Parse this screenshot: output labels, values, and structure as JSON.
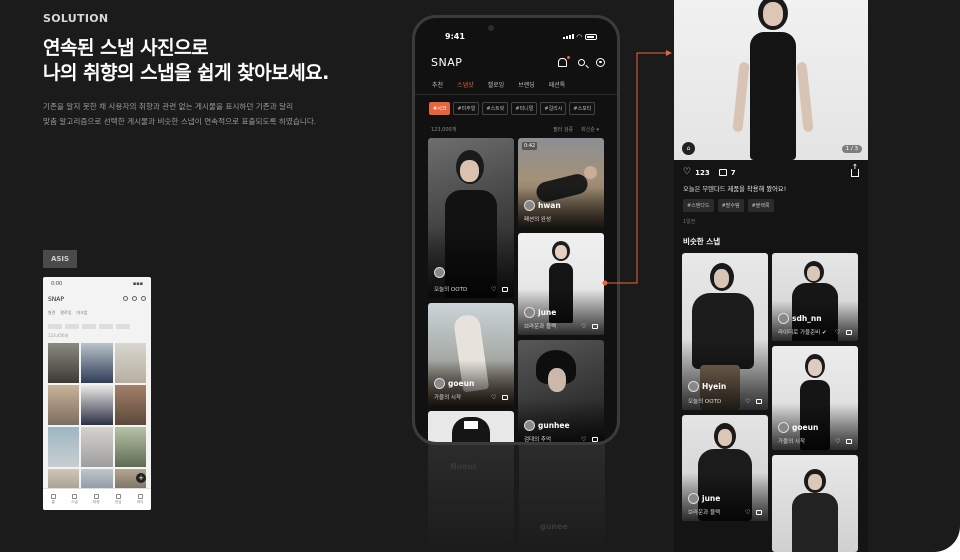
{
  "section_label": "SOLUTION",
  "headline": {
    "line1": "연속된 스냅 사진으로",
    "line2": "나의 취향의 스냅을 쉽게 찾아보세요."
  },
  "description": {
    "line1": "기존을 알지 못한 채 사용자의 취향과 관련 없는 게시물을 표시하던 기존과 달리",
    "line2": "맞춤 알고리즘으로 선택한 게시물과 비슷한 스냅이 연속적으로 표출되도록 하였습니다."
  },
  "asis": {
    "badge": "ASIS",
    "time": "0:00",
    "logo": "SNAP",
    "tabs": [
      "발견",
      "팔로잉",
      "마크업"
    ],
    "count": "123,456개",
    "nav": [
      "홈",
      "스냅",
      "마켓",
      "관심",
      "마이"
    ],
    "fab": "+"
  },
  "phone": {
    "time": "9:41",
    "logo": "SNAP",
    "tabs": [
      {
        "label": "추천",
        "active": false
      },
      {
        "label": "스냅샷",
        "active": true
      },
      {
        "label": "챌로잉",
        "active": false
      },
      {
        "label": "브랜딩",
        "active": false
      },
      {
        "label": "패션톡",
        "active": false
      }
    ],
    "chips": [
      {
        "label": "#시크",
        "active": true
      },
      {
        "label": "#미주얼",
        "active": false
      },
      {
        "label": "#스트릿",
        "active": false
      },
      {
        "label": "#미니멀",
        "active": false
      },
      {
        "label": "#걸리시",
        "active": false
      },
      {
        "label": "#스포티",
        "active": false
      }
    ],
    "count": "123,000개",
    "filter_label": "필터 검증",
    "sort_label": "최신순 ▾",
    "cards": [
      {
        "user": "",
        "caption": "오늘의 OOTD",
        "duration": ""
      },
      {
        "user": "hwan",
        "caption": "패션의 완성",
        "duration": "0:42"
      },
      {
        "user": "june",
        "caption": "브라운과 블랙",
        "duration": ""
      },
      {
        "user": "goeun",
        "caption": "가을의 시작",
        "duration": ""
      },
      {
        "user": "",
        "caption": "",
        "duration": ""
      },
      {
        "user": "gunhee",
        "caption": "검대의 추억",
        "duration": ""
      }
    ],
    "reflection_names": [
      "Noeul",
      "gunee"
    ]
  },
  "detail": {
    "pager": "1 / 3",
    "likes": "123",
    "comments": "7",
    "caption": "오늘은 무텐다드 제품을 착용해 봤어요!",
    "tags": [
      "#스탠다드",
      "#팔수템",
      "#블랙룩"
    ],
    "date": "1일전",
    "similar_title": "비슷한 스냅",
    "similar": [
      {
        "user": "Hyein",
        "caption": "오늘의 OOTD"
      },
      {
        "user": "sdh_nn",
        "caption": "라이더로 가을준비 ✔"
      },
      {
        "user": "goeun",
        "caption": "가을의 시작"
      },
      {
        "user": "june",
        "caption": "브라운과 블랙"
      },
      {
        "user": "",
        "caption": ""
      }
    ]
  },
  "colors": {
    "accent": "#e8643c",
    "background": "#1b1b1b"
  }
}
